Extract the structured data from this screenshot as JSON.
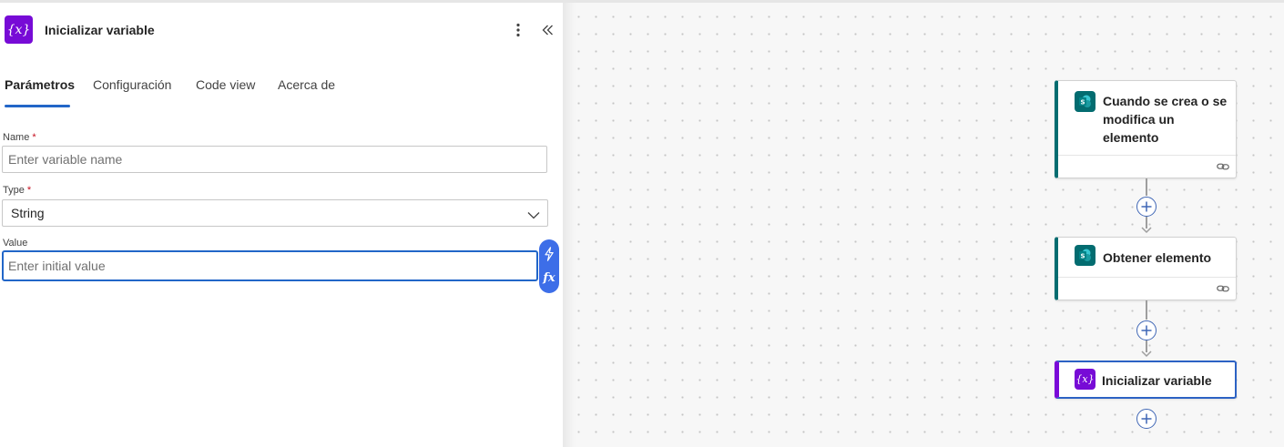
{
  "panel": {
    "title": "Inicializar variable",
    "icon_text": "{x}",
    "tabs": [
      {
        "label": "Parámetros",
        "active": true
      },
      {
        "label": "Configuración",
        "active": false
      },
      {
        "label": "Code view",
        "active": false
      },
      {
        "label": "Acerca de",
        "active": false
      }
    ],
    "fields": {
      "name": {
        "label": "Name",
        "required_mark": "*",
        "placeholder": "Enter variable name",
        "value": ""
      },
      "type": {
        "label": "Type",
        "required_mark": "*",
        "value": "String"
      },
      "value": {
        "label": "Value",
        "placeholder": "Enter initial value",
        "value": ""
      }
    },
    "token_buttons": {
      "fx_label": "fx"
    }
  },
  "canvas": {
    "cards": [
      {
        "title": "Cuando se crea o se modifica un elemento",
        "icon": "sharepoint-icon"
      },
      {
        "title": "Obtener elemento",
        "icon": "sharepoint-icon"
      },
      {
        "title": "Inicializar variable",
        "icon_text": "{x}",
        "icon": "variable-icon",
        "selected": true
      }
    ]
  },
  "colors": {
    "accent": "#2266c8",
    "variable_purple": "#770bd6",
    "sharepoint_teal": "#036c70",
    "required": "#c50f1f",
    "token_blue": "#3d6ee8"
  }
}
